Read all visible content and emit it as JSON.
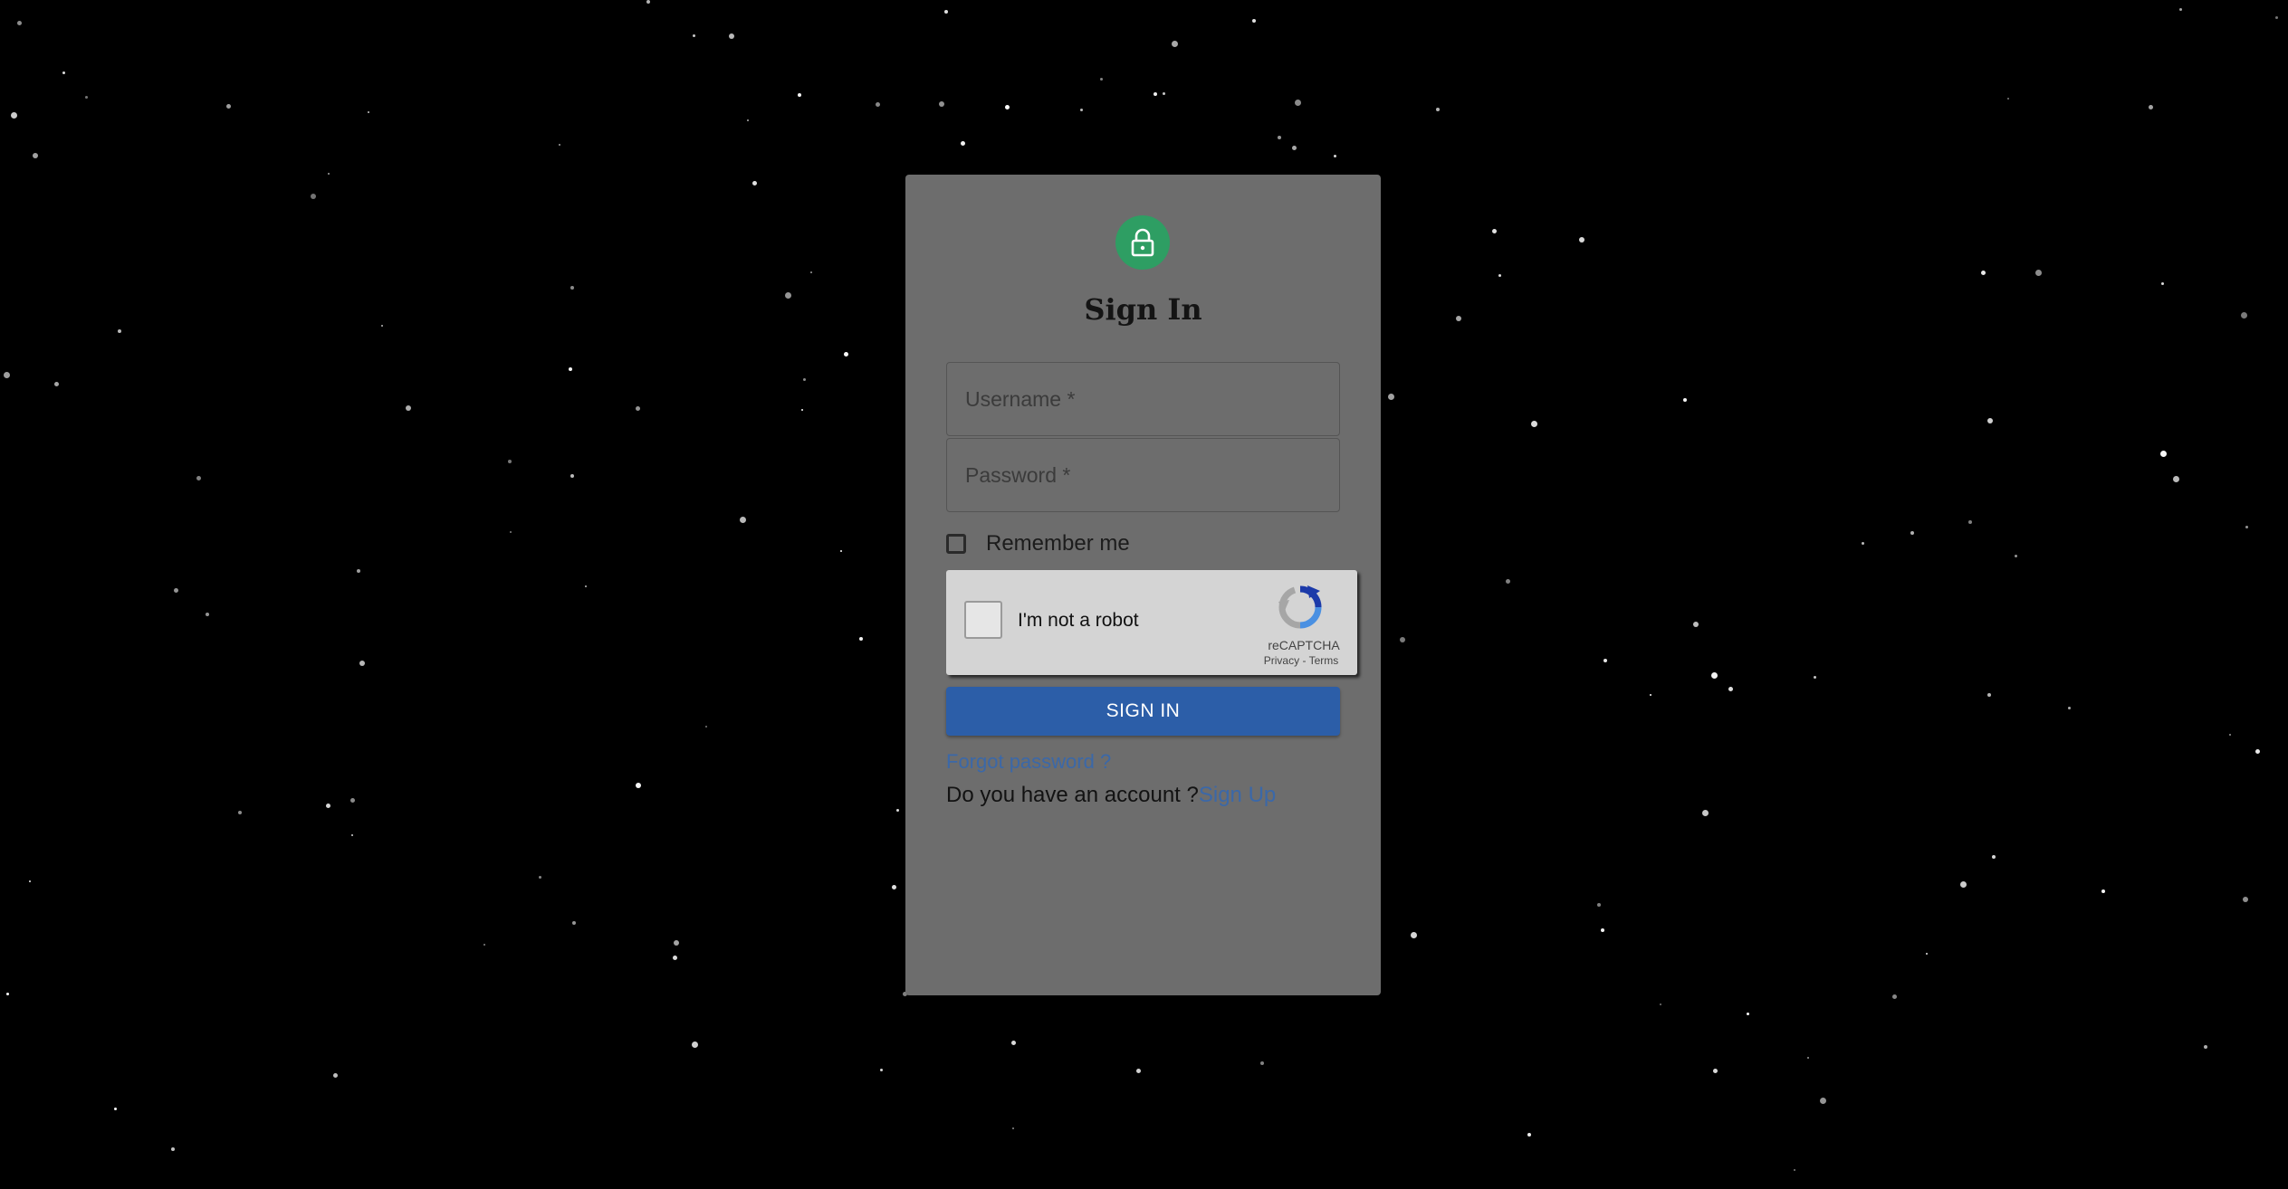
{
  "form": {
    "title": "Sign In",
    "lock_icon": "lock-icon",
    "username_placeholder": "Username *",
    "password_placeholder": "Password *",
    "remember_label": "Remember me",
    "submit_label": "SIGN IN",
    "forgot_label": "Forgot password ?",
    "account_prompt": "Do you have an account ?",
    "signup_label": "Sign Up"
  },
  "recaptcha": {
    "label": "I'm not a robot",
    "brand": "reCAPTCHA",
    "privacy": "Privacy",
    "separator": " - ",
    "terms": "Terms",
    "logo_icon": "recaptcha-logo-icon"
  },
  "colors": {
    "background": "#000000",
    "card": "#6d6d6d",
    "avatar": "#2e9e63",
    "button": "#2c5ea8",
    "link": "#3b68a8"
  }
}
